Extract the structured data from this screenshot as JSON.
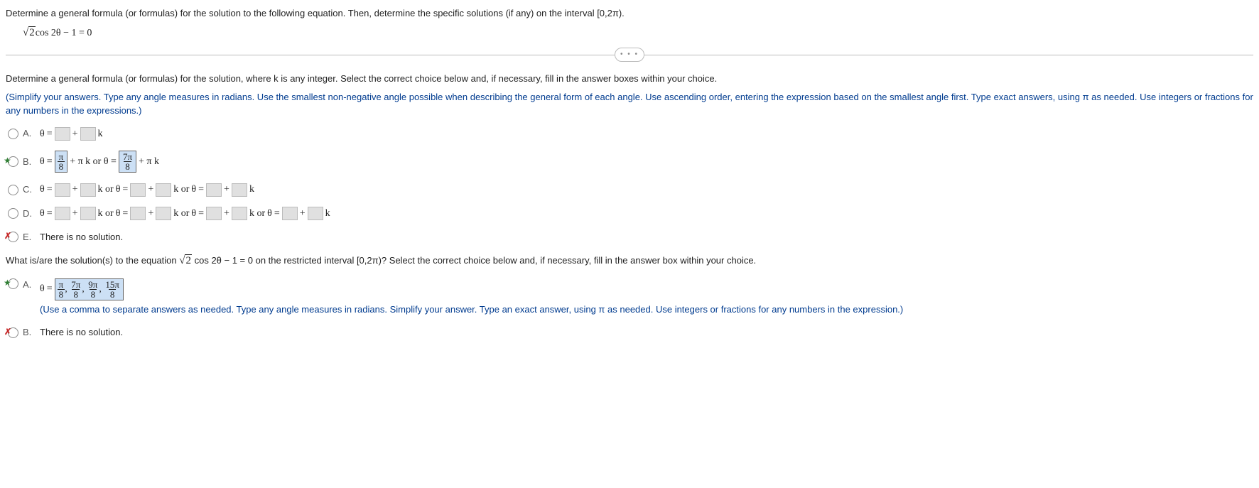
{
  "question": {
    "prompt": "Determine a general formula (or formulas) for the solution to the following equation. Then, determine the specific solutions (if any) on the interval [0,2π).",
    "equation_prefix": "2",
    "equation_rest": " cos 2θ − 1 = 0"
  },
  "divider_label": "• • •",
  "part1": {
    "instruction": "Determine a general formula (or formulas) for the solution, where k is any integer. Select the correct choice below and, if necessary, fill in the answer boxes within your choice.",
    "note": "(Simplify your answers. Type any angle measures in radians. Use the smallest non-negative angle possible when describing the general form of each angle. Use ascending order, entering the expression based on the smallest angle first. Type exact answers, using π as needed. Use integers or fractions for any numbers in the expressions.)",
    "choices": {
      "A": {
        "letter": "A."
      },
      "B": {
        "letter": "B.",
        "frac1_num": "π",
        "frac1_den": "8",
        "mid1": " + π k or θ = ",
        "frac2_num": "7π",
        "frac2_den": "8",
        "tail": " + π k"
      },
      "C": {
        "letter": "C."
      },
      "D": {
        "letter": "D."
      },
      "E": {
        "letter": "E.",
        "text": "There is no solution."
      }
    }
  },
  "part2": {
    "instruction_pre": "What is/are the solution(s) to the equation ",
    "instruction_post": " cos 2θ − 1 = 0 on the restricted interval [0,2π)? Select the correct choice below and, if necessary, fill in the answer box within your choice.",
    "choices": {
      "A": {
        "letter": "A.",
        "answer_parts": [
          "π",
          "7π",
          "9π",
          "15π"
        ],
        "answer_den": "8",
        "note": "(Use a comma to separate answers as needed. Type any angle measures in radians. Simplify your answer. Type an exact answer, using π as needed. Use integers or fractions for any numbers in the expression.)"
      },
      "B": {
        "letter": "B.",
        "text": "There is no solution."
      }
    }
  }
}
